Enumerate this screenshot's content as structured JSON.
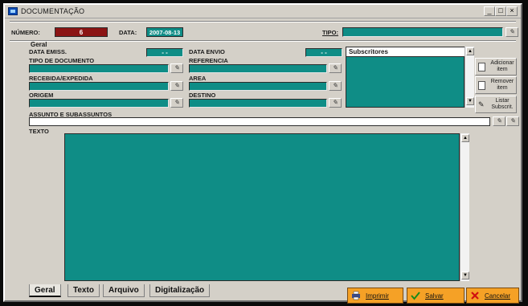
{
  "window": {
    "title": "DOCUMENTAÇÃO",
    "minimize": "_",
    "maximize": "□",
    "close": "×"
  },
  "header": {
    "numero_label": "NÚMERO:",
    "numero_value": "6",
    "data_label": "DATA:",
    "data_value": "2007-08-13",
    "tipo_label": "TIPO:",
    "tipo_value": ""
  },
  "geral": {
    "group_label": "Geral",
    "data_emiss_label": "DATA EMISS.",
    "data_emiss_value": "-   -",
    "data_envio_label": "DATA ENVIO",
    "data_envio_value": "-   -",
    "tipo_documento_label": "TIPO DE DOCUMENTO",
    "referencia_label": "REFERENCIA",
    "recebida_label": "RECEBIDA/EXPEDIDA",
    "area_label": "AREA",
    "origem_label": "ORIGEM",
    "destino_label": "DESTINO",
    "subscritores_label": "Subscritores",
    "assunto_label": "ASSUNTO E SUBASSUNTOS",
    "texto_label": "TEXTO"
  },
  "side_buttons": {
    "adicionar": "Adicionar item",
    "remover": "Remover item",
    "listar": "Listar Subscrit."
  },
  "tabs": [
    "Geral",
    "Texto",
    "Arquivo",
    "Digitalização"
  ],
  "actions": {
    "imprimir": "Imprimir",
    "salvar": "Salvar",
    "cancelar": "Cancelar"
  },
  "colors": {
    "field": "#0f8d86",
    "numero": "#8b1414",
    "action": "#f5a126"
  }
}
